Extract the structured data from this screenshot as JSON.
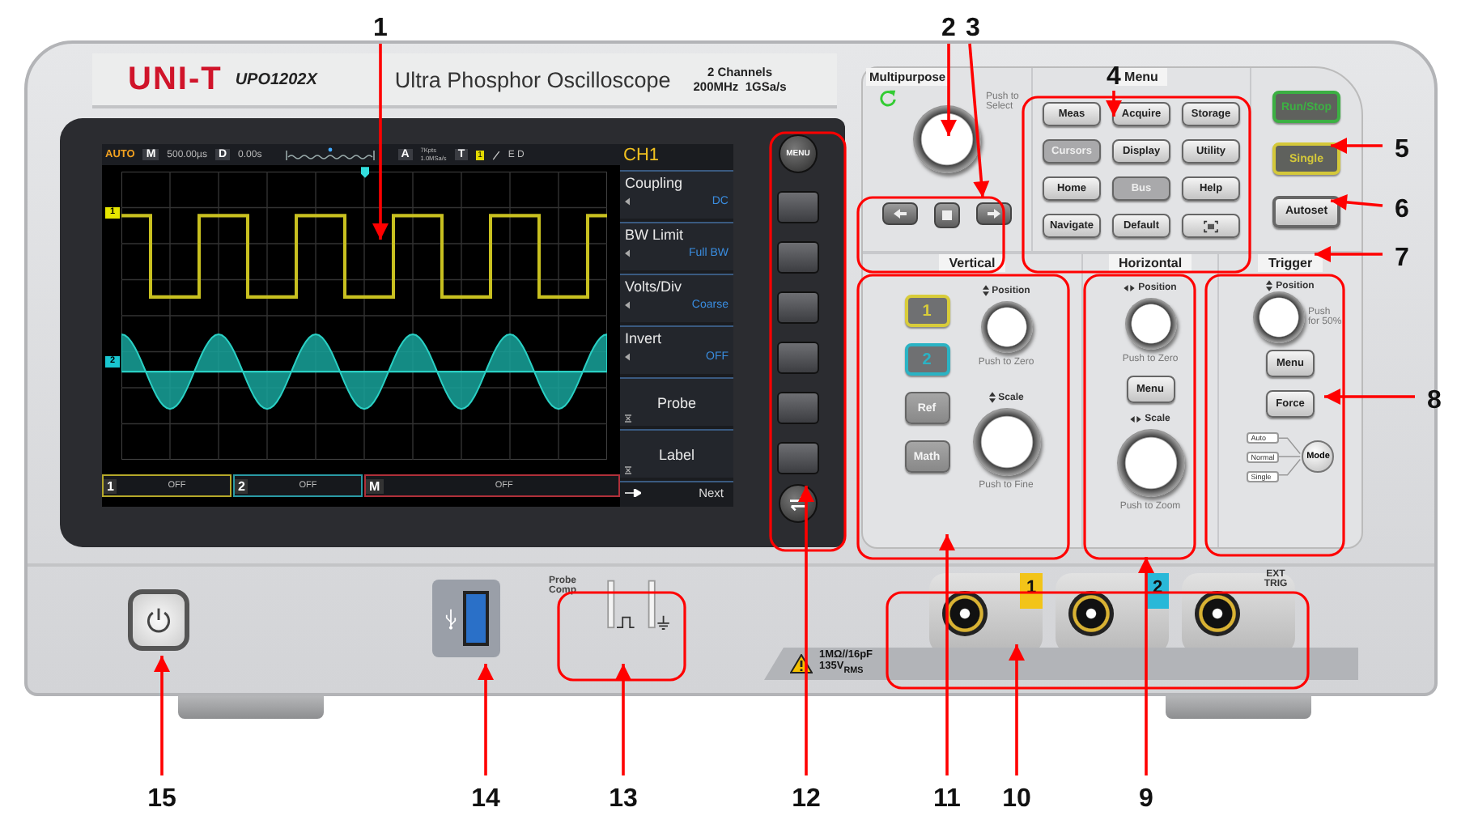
{
  "header": {
    "brand": "UNI-T",
    "model": "UPO1202X",
    "title": "Ultra Phosphor Oscilloscope",
    "spec_lines": [
      "2 Channels",
      "200MHz  1GSa/s"
    ]
  },
  "screen": {
    "status_bar": {
      "mode": "AUTO",
      "timebase_label": "M",
      "timebase": "500.00µs",
      "delay_label": "D",
      "delay": "0.00s",
      "acq_label": "A",
      "acq_lines": [
        "7Kpts",
        "1.0MSa/s"
      ],
      "trigger_label": "T",
      "trigger_source": "1",
      "trigger_extra": "E D"
    },
    "markers": [
      {
        "label": "1",
        "color": "#e6e600"
      },
      {
        "label": "2",
        "color": "#19c6d0"
      }
    ],
    "menu": {
      "title": "CH1",
      "items": [
        {
          "kind": "option",
          "name": "Coupling",
          "value": "DC"
        },
        {
          "kind": "option",
          "name": "BW Limit",
          "value": "Full BW"
        },
        {
          "kind": "option",
          "name": "Volts/Div",
          "value": "Coarse"
        },
        {
          "kind": "option",
          "name": "Invert",
          "value": "OFF"
        },
        {
          "kind": "submenu",
          "name": "Probe"
        },
        {
          "kind": "submenu",
          "name": "Label"
        }
      ],
      "next": "Next"
    },
    "channel_bar": [
      {
        "label": "1",
        "value": "OFF",
        "color": "#b5a82a"
      },
      {
        "label": "2",
        "value": "OFF",
        "color": "#2a9aa5"
      },
      {
        "label": "M",
        "value": "OFF",
        "color": "#b0303a"
      }
    ]
  },
  "softkeys": {
    "menu_button": "MENU"
  },
  "panel": {
    "multipurpose": {
      "title": "Multipurpose",
      "hint": "Push to Select"
    },
    "menu": {
      "title": "Menu",
      "buttons": [
        {
          "kind": "text",
          "label": "Meas",
          "lit": false
        },
        {
          "kind": "text",
          "label": "Acquire",
          "lit": false
        },
        {
          "kind": "text",
          "label": "Storage",
          "lit": false
        },
        {
          "kind": "text",
          "label": "Cursors",
          "lit": true
        },
        {
          "kind": "text",
          "label": "Display",
          "lit": false
        },
        {
          "kind": "text",
          "label": "Utility",
          "lit": false
        },
        {
          "kind": "text",
          "label": "Home",
          "lit": false
        },
        {
          "kind": "text",
          "label": "Bus",
          "lit": true
        },
        {
          "kind": "text",
          "label": "Help",
          "lit": false
        },
        {
          "kind": "text",
          "label": "Navigate",
          "lit": false
        },
        {
          "kind": "text",
          "label": "Default",
          "lit": false
        },
        {
          "kind": "icon",
          "lit": false
        }
      ]
    },
    "run_controls": [
      {
        "label": "Run/Stop",
        "color": "#3cb043"
      },
      {
        "label": "Single",
        "color": "#d4c83a"
      },
      {
        "label": "Autoset"
      }
    ],
    "vertical": {
      "title": "Vertical",
      "position_label": "Position",
      "position_hint": "Push to Zero",
      "scale_label": "Scale",
      "scale_hint": "Push to Fine",
      "buttons": [
        {
          "label": "1",
          "color": "#d8cc3a"
        },
        {
          "label": "2",
          "color": "#2bb3c4"
        },
        {
          "label": "Ref"
        },
        {
          "label": "Math"
        }
      ]
    },
    "horizontal": {
      "title": "Horizontal",
      "position_label": "Position",
      "position_hint": "Push to Zero",
      "menu_button": "Menu",
      "scale_label": "Scale",
      "scale_hint": "Push to Zoom"
    },
    "trigger": {
      "title": "Trigger",
      "position_label": "Position",
      "position_hint": "Push for 50%",
      "menu_button": "Menu",
      "force_button": "Force",
      "modes": [
        "Auto",
        "Normal",
        "Single"
      ],
      "mode_button": "Mode"
    }
  },
  "front": {
    "probe_comp": "Probe Comp",
    "input_rating": [
      "1MΩ//16pF",
      "135V$_{RMS}$"
    ],
    "inputs": [
      {
        "label": "1",
        "color": "#f2c419"
      },
      {
        "label": "2",
        "color": "#29b8d8"
      },
      {
        "label": "EXT TRIG"
      }
    ]
  },
  "callouts": [
    {
      "number": "1"
    },
    {
      "number": "2"
    },
    {
      "number": "3"
    },
    {
      "number": "4"
    },
    {
      "number": "5"
    },
    {
      "number": "6"
    },
    {
      "number": "7"
    },
    {
      "number": "8"
    },
    {
      "number": "15"
    },
    {
      "number": "14"
    },
    {
      "number": "13"
    },
    {
      "number": "12"
    },
    {
      "number": "11"
    },
    {
      "number": "10"
    },
    {
      "number": "9"
    }
  ]
}
